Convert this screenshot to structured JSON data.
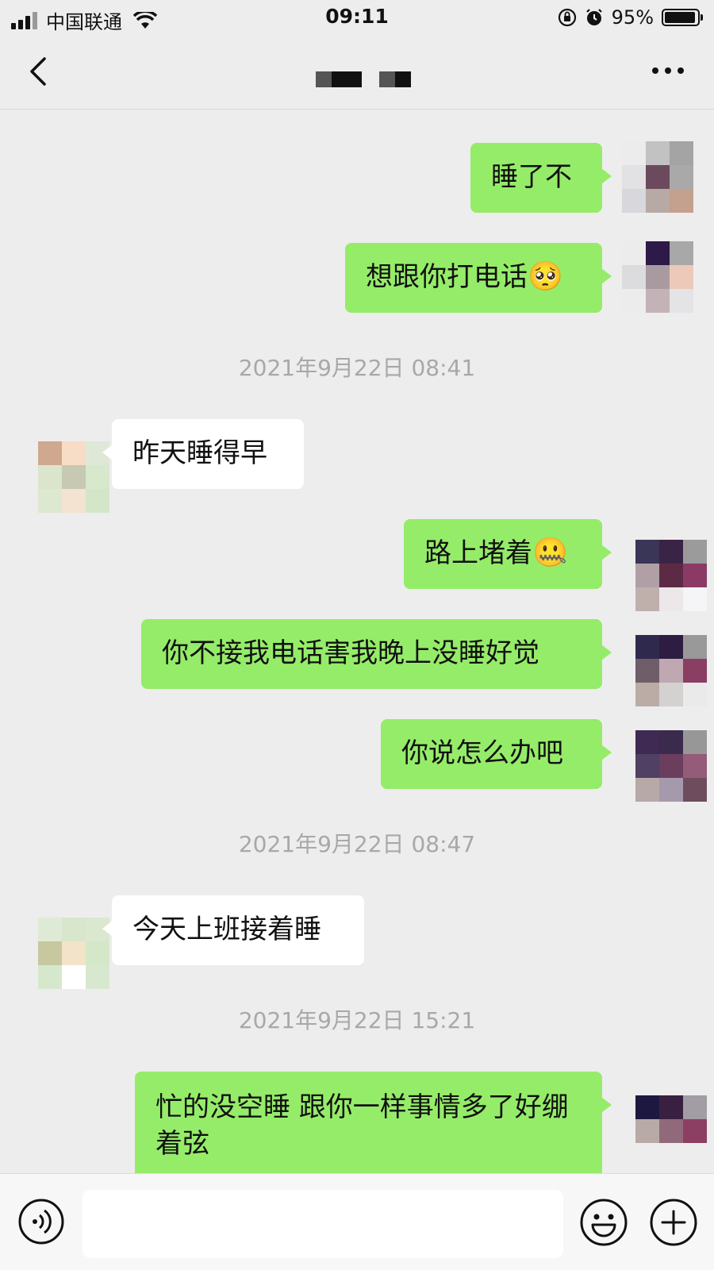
{
  "status_bar": {
    "carrier": "中国联通",
    "time": "09:11",
    "battery_percent": "95%",
    "battery_level": 0.95
  },
  "header": {
    "title": "",
    "back_icon": "chevron-left-icon",
    "more_icon": "more-dots-icon"
  },
  "messages": [
    {
      "type": "sent",
      "text": "睡了不"
    },
    {
      "type": "sent",
      "text": "想跟你打电话",
      "emoji": "🥺"
    },
    {
      "type": "timestamp",
      "text": "2021年9月22日 08:41"
    },
    {
      "type": "received",
      "text": "昨天睡得早"
    },
    {
      "type": "sent",
      "text": "路上堵着",
      "emoji": "🤐"
    },
    {
      "type": "sent",
      "text": "你不接我电话害我晚上没睡好觉"
    },
    {
      "type": "sent",
      "text": "你说怎么办吧"
    },
    {
      "type": "timestamp",
      "text": "2021年9月22日 08:47"
    },
    {
      "type": "received",
      "text": "今天上班接着睡"
    },
    {
      "type": "timestamp",
      "text": "2021年9月22日 15:21"
    },
    {
      "type": "sent",
      "text": "忙的没空睡 跟你一样事情多了好绷着弦"
    }
  ],
  "input_bar": {
    "voice_icon": "voice-icon",
    "emoji_icon": "smiley-icon",
    "plus_icon": "plus-icon",
    "placeholder": ""
  },
  "colors": {
    "sent_bubble": "#95ec69",
    "received_bubble": "#ffffff",
    "background": "#ededed",
    "timestamp": "#a8a8a8"
  }
}
